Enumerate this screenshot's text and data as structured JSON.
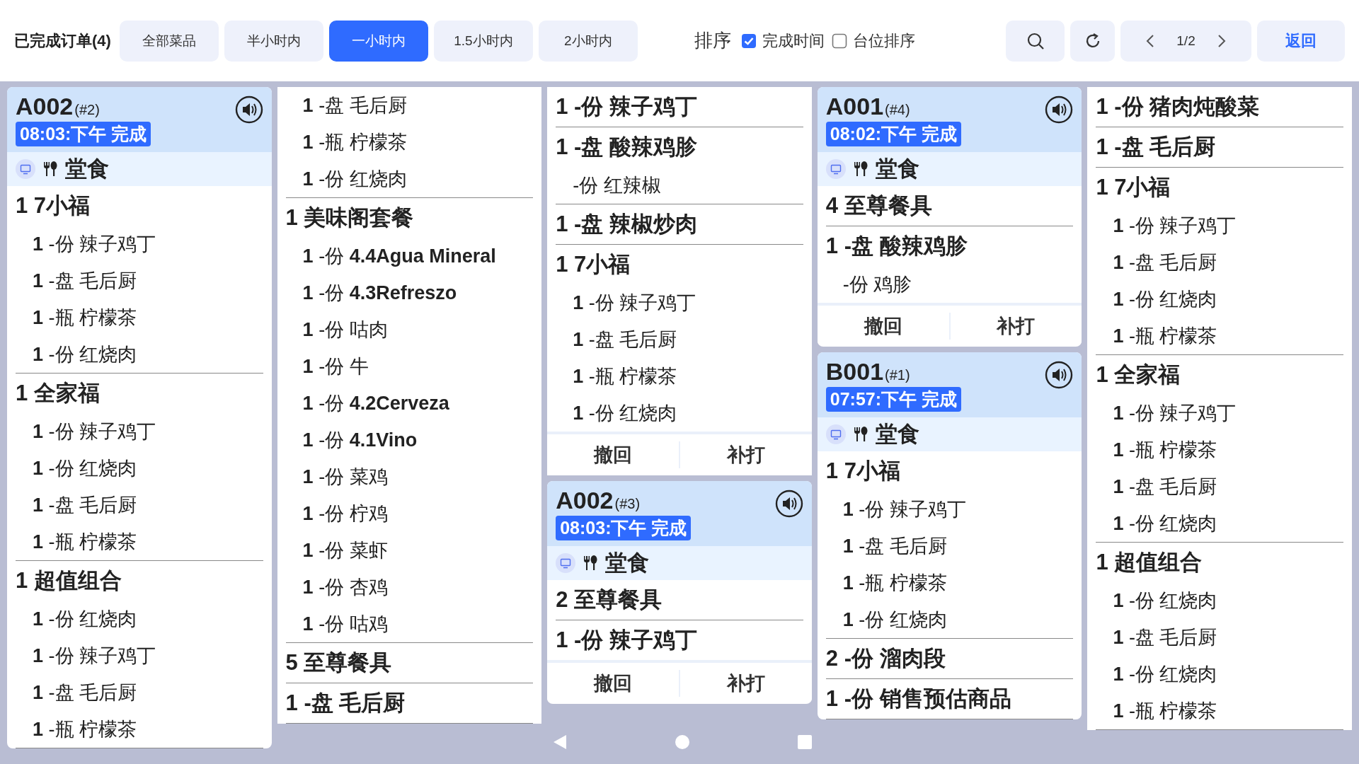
{
  "toolbar": {
    "title": "已完成订单(4)",
    "filters": [
      {
        "label": "全部菜品",
        "selected": false
      },
      {
        "label": "半小时内",
        "selected": false
      },
      {
        "label": "一小时内",
        "selected": true
      },
      {
        "label": "1.5小时内",
        "selected": false
      },
      {
        "label": "2小时内",
        "selected": false
      }
    ],
    "sort": {
      "label": "排序",
      "options": [
        {
          "label": "完成时间",
          "checked": true
        },
        {
          "label": "台位排序",
          "checked": false
        }
      ]
    },
    "page": "1/2",
    "back": "返回"
  },
  "columns": [
    {
      "blocks": [
        {
          "kind": "card",
          "table": "A002",
          "seq": "(#2)",
          "status": "08:03:下午 完成",
          "service": "堂食",
          "items": [
            {
              "text": "1 7小福",
              "children": [
                {
                  "text": "**1** -份 辣子鸡丁"
                },
                {
                  "text": "**1** -盘 毛后厨"
                },
                {
                  "text": "**1** -瓶 柠檬茶"
                },
                {
                  "text": "**1** -份 红烧肉"
                }
              ]
            },
            {
              "text": "1 全家福",
              "children": [
                {
                  "text": "**1** -份 辣子鸡丁"
                },
                {
                  "text": "**1** -份 红烧肉"
                },
                {
                  "text": "**1** -盘 毛后厨"
                },
                {
                  "text": "**1** -瓶 柠檬茶"
                }
              ]
            },
            {
              "text": "1 超值组合",
              "children": [
                {
                  "text": "**1** -份 红烧肉"
                },
                {
                  "text": "**1** -份 辣子鸡丁"
                },
                {
                  "text": "**1** -盘 毛后厨"
                },
                {
                  "text": "**1** -瓶 柠檬茶"
                }
              ]
            }
          ]
        }
      ]
    },
    {
      "blocks": [
        {
          "kind": "continuation",
          "items": [
            {
              "children": [
                {
                  "text": "**1** -盘 毛后厨"
                },
                {
                  "text": "**1** -瓶 柠檬茶"
                },
                {
                  "text": "**1** -份 红烧肉"
                }
              ]
            },
            {
              "text": "1 美味阁套餐",
              "children": [
                {
                  "text": "**1** -份 **4.4Agua Mineral**"
                },
                {
                  "text": "**1** -份 **4.3Refreszo**"
                },
                {
                  "text": "**1** -份 咕肉"
                },
                {
                  "text": "**1** -份 牛"
                },
                {
                  "text": "**1** -份 **4.2Cerveza**"
                },
                {
                  "text": "**1** -份 **4.1Vino**"
                },
                {
                  "text": "**1** -份 菜鸡"
                },
                {
                  "text": "**1** -份 柠鸡"
                },
                {
                  "text": "**1** -份 菜虾"
                },
                {
                  "text": "**1** -份 杏鸡"
                },
                {
                  "text": "**1** -份 咕鸡"
                }
              ]
            },
            {
              "text": "5 至尊餐具"
            },
            {
              "text": "1 -盘 毛后厨"
            }
          ]
        }
      ]
    },
    {
      "blocks": [
        {
          "kind": "continuation",
          "items": [
            {
              "text": "1 -份 辣子鸡丁"
            },
            {
              "text": "1 -盘 酸辣鸡胗",
              "children": [
                {
                  "text": "-份 红辣椒"
                }
              ]
            },
            {
              "text": "1 -盘 辣椒炒肉"
            },
            {
              "text": "1 7小福",
              "children": [
                {
                  "text": "**1** -份 辣子鸡丁"
                },
                {
                  "text": "**1** -盘 毛后厨"
                },
                {
                  "text": "**1** -瓶 柠檬茶"
                },
                {
                  "text": "**1** -份 红烧肉"
                }
              ]
            }
          ],
          "actions": [
            "撤回",
            "补打"
          ]
        },
        {
          "kind": "card",
          "table": "A002",
          "seq": "(#3)",
          "status": "08:03:下午 完成",
          "service": "堂食",
          "items": [
            {
              "text": "2 至尊餐具"
            },
            {
              "text": "1 -份 辣子鸡丁"
            }
          ],
          "actions": [
            "撤回",
            "补打"
          ]
        }
      ]
    },
    {
      "blocks": [
        {
          "kind": "card",
          "table": "A001",
          "seq": "(#4)",
          "status": "08:02:下午 完成",
          "service": "堂食",
          "items": [
            {
              "text": "4 至尊餐具"
            },
            {
              "text": "1 -盘 酸辣鸡胗",
              "children": [
                {
                  "text": "-份 鸡胗"
                }
              ]
            }
          ],
          "actions": [
            "撤回",
            "补打"
          ]
        },
        {
          "kind": "card",
          "table": "B001",
          "seq": "(#1)",
          "status": "07:57:下午 完成",
          "service": "堂食",
          "items": [
            {
              "text": "1 7小福",
              "children": [
                {
                  "text": "**1** -份 辣子鸡丁"
                },
                {
                  "text": "**1** -盘 毛后厨"
                },
                {
                  "text": "**1** -瓶 柠檬茶"
                },
                {
                  "text": "**1** -份 红烧肉"
                }
              ]
            },
            {
              "text": "2 -份 溜肉段"
            },
            {
              "text": "1 -份 销售预估商品"
            }
          ]
        }
      ]
    },
    {
      "blocks": [
        {
          "kind": "continuation",
          "items": [
            {
              "text": "1 -份 猪肉炖酸菜"
            },
            {
              "text": "1 -盘 毛后厨"
            },
            {
              "text": "1 7小福",
              "children": [
                {
                  "text": "**1** -份 辣子鸡丁"
                },
                {
                  "text": "**1** -盘 毛后厨"
                },
                {
                  "text": "**1** -份 红烧肉"
                },
                {
                  "text": "**1** -瓶 柠檬茶"
                }
              ]
            },
            {
              "text": "1 全家福",
              "children": [
                {
                  "text": "**1** -份 辣子鸡丁"
                },
                {
                  "text": "**1** -瓶 柠檬茶"
                },
                {
                  "text": "**1** -盘 毛后厨"
                },
                {
                  "text": "**1** -份 红烧肉"
                }
              ]
            },
            {
              "text": "1 超值组合",
              "children": [
                {
                  "text": "**1** -份 红烧肉"
                },
                {
                  "text": "**1** -盘 毛后厨"
                },
                {
                  "text": "**1** -份 红烧肉"
                },
                {
                  "text": "**1** -瓶 柠檬茶"
                }
              ]
            }
          ]
        }
      ]
    }
  ]
}
